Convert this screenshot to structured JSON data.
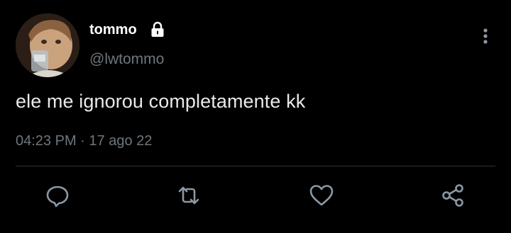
{
  "user": {
    "display_name": "tommo",
    "handle": "@lwtommo",
    "avatar_icon": "avatar",
    "protected_icon": "lock-icon"
  },
  "tweet": {
    "text": "ele me ignorou completamente kk",
    "time": "04:23 PM",
    "separator": "·",
    "date": "17 ago 22"
  },
  "actions": [
    {
      "name": "reply",
      "icon": "reply-icon"
    },
    {
      "name": "retweet",
      "icon": "retweet-icon"
    },
    {
      "name": "like",
      "icon": "heart-icon"
    },
    {
      "name": "share",
      "icon": "share-icon"
    }
  ],
  "colors": {
    "background": "#000000",
    "primary_text": "#e7e9ea",
    "secondary_text": "#6e767d",
    "divider": "#2f3336",
    "icon": "#8b98a5"
  }
}
